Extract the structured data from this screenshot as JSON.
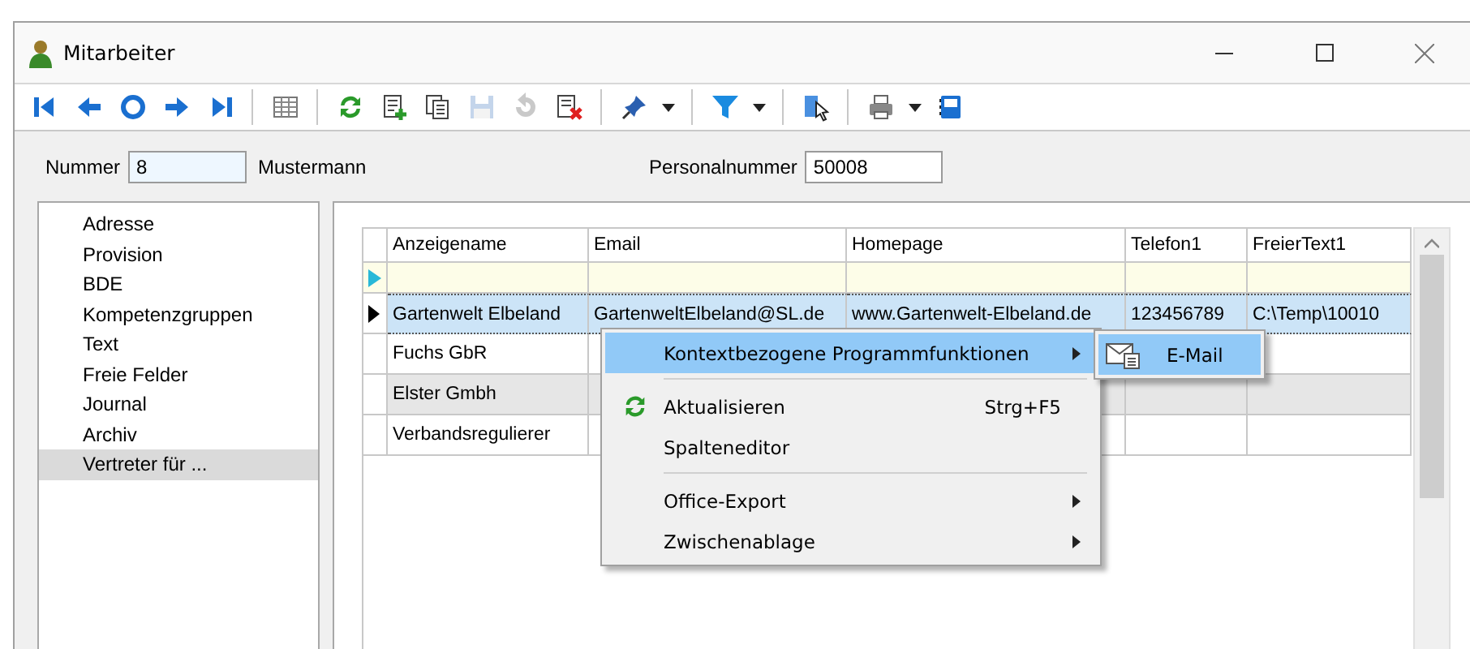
{
  "window": {
    "title": "Mitarbeiter"
  },
  "toolbar": [
    {
      "disabled": false
    },
    {
      "disabled": false
    },
    {
      "disabled": false
    },
    {
      "disabled": false
    },
    {
      "disabled": false
    },
    {
      "disabled": false
    },
    {
      "disabled": false
    },
    {
      "disabled": false
    },
    {
      "disabled": false
    },
    {
      "disabled": true
    },
    {
      "disabled": true
    },
    {
      "disabled": false
    },
    {
      "disabled": false
    },
    {
      "disabled": false
    },
    {
      "disabled": false
    },
    {
      "disabled": false
    },
    {
      "disabled": false
    }
  ],
  "form": {
    "nummer_label": "Nummer",
    "nummer_value": "8",
    "name": "Mustermann",
    "personalnummer_label": "Personalnummer",
    "personalnummer_value": "50008"
  },
  "sidebar": {
    "items": [
      {
        "label": "Adresse",
        "selected": false
      },
      {
        "label": "Provision",
        "selected": false
      },
      {
        "label": "BDE",
        "selected": false
      },
      {
        "label": "Kompetenzgruppen",
        "selected": false
      },
      {
        "label": "Text",
        "selected": false
      },
      {
        "label": "Freie Felder",
        "selected": false
      },
      {
        "label": "Journal",
        "selected": false
      },
      {
        "label": "Archiv",
        "selected": false
      },
      {
        "label": "Vertreter für ...",
        "selected": true
      }
    ]
  },
  "table": {
    "columns": [
      "Anzeigename",
      "Email",
      "Homepage",
      "Telefon1",
      "FreierText1"
    ],
    "rows": [
      {
        "kind": "new",
        "selected": false,
        "shaded": false,
        "cells": []
      },
      {
        "kind": "data",
        "selected": true,
        "shaded": false,
        "cells": [
          "Gartenwelt Elbeland",
          "GartenweltElbeland@SL.de",
          "www.Gartenwelt-Elbeland.de",
          "123456789",
          "C:\\Temp\\10010"
        ]
      },
      {
        "kind": "data",
        "selected": false,
        "shaded": false,
        "cells": [
          "Fuchs GbR"
        ]
      },
      {
        "kind": "data",
        "selected": false,
        "shaded": true,
        "cells": [
          "Elster Gmbh"
        ]
      },
      {
        "kind": "data",
        "selected": false,
        "shaded": false,
        "cells": [
          "Verbandsregulierer"
        ]
      }
    ]
  },
  "context_menu": {
    "items": [
      {
        "kind": "item",
        "label": "Kontextbezogene Programmfunktionen",
        "submenu": true,
        "selected": true
      },
      {
        "kind": "separator"
      },
      {
        "kind": "icon-item",
        "label": "Aktualisieren",
        "shortcut": "Strg+F5",
        "submenu": false,
        "selected": false
      },
      {
        "kind": "item",
        "label": "Spalteneditor",
        "submenu": false,
        "selected": false
      },
      {
        "kind": "separator"
      },
      {
        "kind": "item",
        "label": "Office-Export",
        "submenu": true,
        "selected": false
      },
      {
        "kind": "item",
        "label": "Zwischenablage",
        "submenu": true,
        "selected": false
      }
    ],
    "submenu": {
      "items": [
        {
          "label": "E-Mail",
          "selected": true
        }
      ]
    }
  }
}
